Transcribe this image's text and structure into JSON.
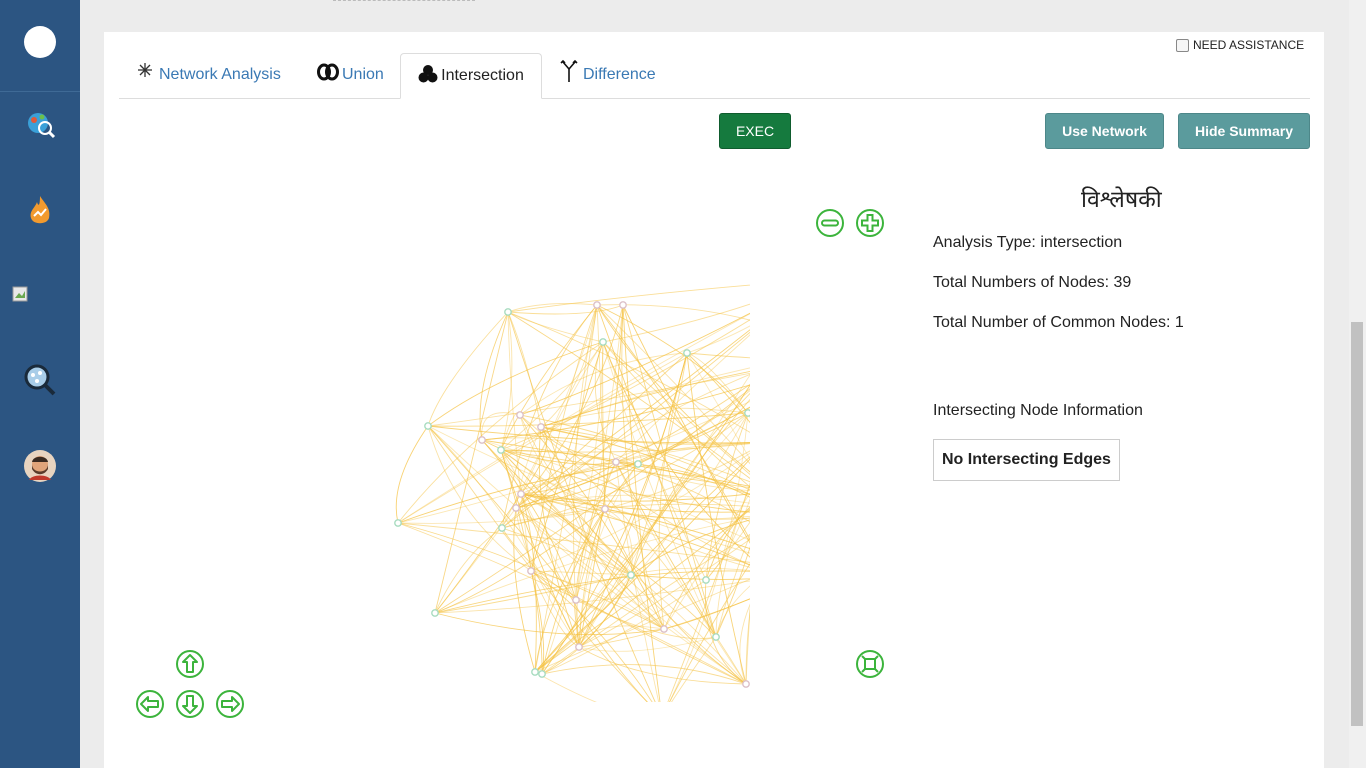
{
  "sidebar": {
    "items": [
      {
        "icon": "logo-icon"
      },
      {
        "icon": "world-analysis-icon"
      },
      {
        "icon": "fire-trend-icon"
      },
      {
        "icon": "broken-image-icon"
      },
      {
        "icon": "network-search-icon"
      },
      {
        "icon": "user-avatar-icon"
      }
    ]
  },
  "header": {
    "need_assistance": "NEED ASSISTANCE"
  },
  "tabs": [
    {
      "label": "Network Analysis",
      "icon": "asterisk-icon"
    },
    {
      "label": "Union",
      "icon": "union-icon"
    },
    {
      "label": "Intersection",
      "icon": "intersection-icon"
    },
    {
      "label": "Difference",
      "icon": "fork-icon"
    }
  ],
  "toolbar": {
    "exec_label": "EXEC",
    "use_network_label": "Use Network",
    "hide_summary_label": "Hide Summary"
  },
  "summary": {
    "title": "विश्लेषकी",
    "analysis_type": "Analysis Type: intersection",
    "total_nodes": "Total Numbers of Nodes: 39",
    "common_nodes": "Total Number of Common Nodes: 1",
    "intersecting_heading": "Intersecting Node Information",
    "no_edges": "No Intersecting Edges"
  },
  "graph": {
    "edge_color": "#f5c242",
    "node_green": "#a8dcc0",
    "node_pink": "#dcc0c8",
    "common_node_color": "#ff0000"
  }
}
